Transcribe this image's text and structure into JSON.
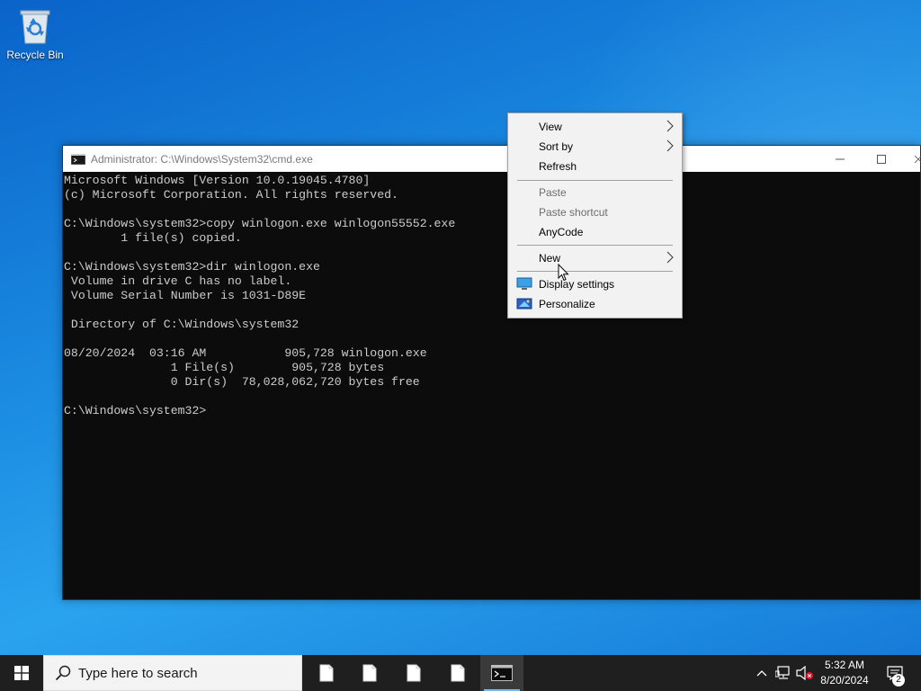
{
  "desktop": {
    "icons": [
      {
        "label": "Recycle Bin",
        "icon": "recycle-bin-icon"
      }
    ]
  },
  "cmd_window": {
    "title": "Administrator: C:\\Windows\\System32\\cmd.exe",
    "controls": {
      "minimize": "minimize-icon",
      "maximize": "maximize-icon",
      "close": "close-icon"
    },
    "lines": [
      "Microsoft Windows [Version 10.0.19045.4780]",
      "(c) Microsoft Corporation. All rights reserved.",
      "",
      "C:\\Windows\\system32>copy winlogon.exe winlogon55552.exe",
      "        1 file(s) copied.",
      "",
      "C:\\Windows\\system32>dir winlogon.exe",
      " Volume in drive C has no label.",
      " Volume Serial Number is 1031-D89E",
      "",
      " Directory of C:\\Windows\\system32",
      "",
      "08/20/2024  03:16 AM           905,728 winlogon.exe",
      "               1 File(s)        905,728 bytes",
      "               0 Dir(s)  78,028,062,720 bytes free",
      "",
      "C:\\Windows\\system32>"
    ]
  },
  "context_menu": {
    "items": [
      {
        "label": "View",
        "submenu": true,
        "disabled": false
      },
      {
        "label": "Sort by",
        "submenu": true,
        "disabled": false
      },
      {
        "label": "Refresh",
        "submenu": false,
        "disabled": false
      },
      {
        "label": "Paste",
        "submenu": false,
        "disabled": true
      },
      {
        "label": "Paste shortcut",
        "submenu": false,
        "disabled": true
      },
      {
        "label": "AnyCode",
        "submenu": false,
        "disabled": false
      },
      {
        "label": "New",
        "submenu": true,
        "disabled": false
      },
      {
        "label": "Display settings",
        "submenu": false,
        "disabled": false,
        "icon": "display-settings-icon"
      },
      {
        "label": "Personalize",
        "submenu": false,
        "disabled": false,
        "icon": "personalize-icon"
      }
    ]
  },
  "taskbar": {
    "start_icon": "windows-logo-icon",
    "search_placeholder": "Type here to search",
    "apps": [
      {
        "icon": "document-icon"
      },
      {
        "icon": "document-icon"
      },
      {
        "icon": "document-icon"
      },
      {
        "icon": "document-icon"
      },
      {
        "icon": "command-prompt-icon",
        "active": true
      }
    ],
    "tray_icons": [
      "chevron-up-icon",
      "network-icon",
      "volume-muted-icon"
    ],
    "clock": {
      "time": "5:32 AM",
      "date": "8/20/2024"
    },
    "notifications": {
      "icon": "action-center-icon",
      "count": "2"
    }
  },
  "colors": {
    "terminal_bg": "#0c0c0c",
    "terminal_text": "#cccccc",
    "taskbar_bg": "#1f1f1f",
    "menu_bg": "#f2f2f2",
    "desktop_blue": "#1a8ae0"
  }
}
